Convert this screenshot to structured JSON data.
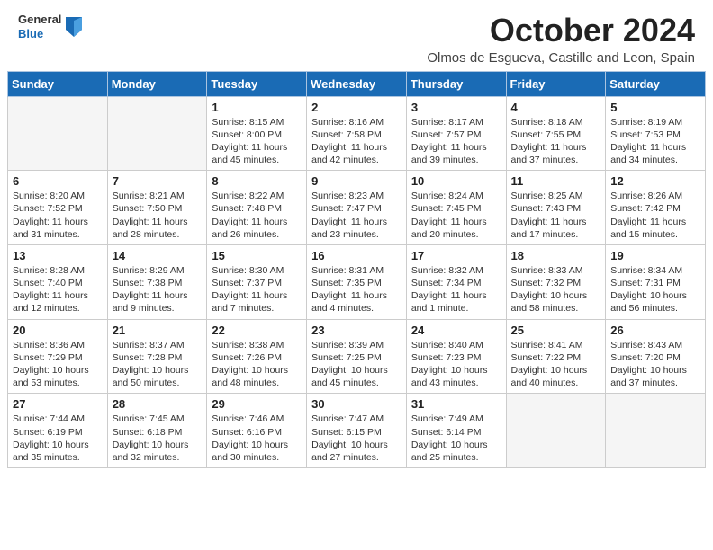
{
  "header": {
    "logo_line1": "General",
    "logo_line2": "Blue",
    "month_title": "October 2024",
    "location": "Olmos de Esgueva, Castille and Leon, Spain"
  },
  "days_of_week": [
    "Sunday",
    "Monday",
    "Tuesday",
    "Wednesday",
    "Thursday",
    "Friday",
    "Saturday"
  ],
  "weeks": [
    [
      {
        "day": "",
        "info": ""
      },
      {
        "day": "",
        "info": ""
      },
      {
        "day": "1",
        "info": "Sunrise: 8:15 AM\nSunset: 8:00 PM\nDaylight: 11 hours and 45 minutes."
      },
      {
        "day": "2",
        "info": "Sunrise: 8:16 AM\nSunset: 7:58 PM\nDaylight: 11 hours and 42 minutes."
      },
      {
        "day": "3",
        "info": "Sunrise: 8:17 AM\nSunset: 7:57 PM\nDaylight: 11 hours and 39 minutes."
      },
      {
        "day": "4",
        "info": "Sunrise: 8:18 AM\nSunset: 7:55 PM\nDaylight: 11 hours and 37 minutes."
      },
      {
        "day": "5",
        "info": "Sunrise: 8:19 AM\nSunset: 7:53 PM\nDaylight: 11 hours and 34 minutes."
      }
    ],
    [
      {
        "day": "6",
        "info": "Sunrise: 8:20 AM\nSunset: 7:52 PM\nDaylight: 11 hours and 31 minutes."
      },
      {
        "day": "7",
        "info": "Sunrise: 8:21 AM\nSunset: 7:50 PM\nDaylight: 11 hours and 28 minutes."
      },
      {
        "day": "8",
        "info": "Sunrise: 8:22 AM\nSunset: 7:48 PM\nDaylight: 11 hours and 26 minutes."
      },
      {
        "day": "9",
        "info": "Sunrise: 8:23 AM\nSunset: 7:47 PM\nDaylight: 11 hours and 23 minutes."
      },
      {
        "day": "10",
        "info": "Sunrise: 8:24 AM\nSunset: 7:45 PM\nDaylight: 11 hours and 20 minutes."
      },
      {
        "day": "11",
        "info": "Sunrise: 8:25 AM\nSunset: 7:43 PM\nDaylight: 11 hours and 17 minutes."
      },
      {
        "day": "12",
        "info": "Sunrise: 8:26 AM\nSunset: 7:42 PM\nDaylight: 11 hours and 15 minutes."
      }
    ],
    [
      {
        "day": "13",
        "info": "Sunrise: 8:28 AM\nSunset: 7:40 PM\nDaylight: 11 hours and 12 minutes."
      },
      {
        "day": "14",
        "info": "Sunrise: 8:29 AM\nSunset: 7:38 PM\nDaylight: 11 hours and 9 minutes."
      },
      {
        "day": "15",
        "info": "Sunrise: 8:30 AM\nSunset: 7:37 PM\nDaylight: 11 hours and 7 minutes."
      },
      {
        "day": "16",
        "info": "Sunrise: 8:31 AM\nSunset: 7:35 PM\nDaylight: 11 hours and 4 minutes."
      },
      {
        "day": "17",
        "info": "Sunrise: 8:32 AM\nSunset: 7:34 PM\nDaylight: 11 hours and 1 minute."
      },
      {
        "day": "18",
        "info": "Sunrise: 8:33 AM\nSunset: 7:32 PM\nDaylight: 10 hours and 58 minutes."
      },
      {
        "day": "19",
        "info": "Sunrise: 8:34 AM\nSunset: 7:31 PM\nDaylight: 10 hours and 56 minutes."
      }
    ],
    [
      {
        "day": "20",
        "info": "Sunrise: 8:36 AM\nSunset: 7:29 PM\nDaylight: 10 hours and 53 minutes."
      },
      {
        "day": "21",
        "info": "Sunrise: 8:37 AM\nSunset: 7:28 PM\nDaylight: 10 hours and 50 minutes."
      },
      {
        "day": "22",
        "info": "Sunrise: 8:38 AM\nSunset: 7:26 PM\nDaylight: 10 hours and 48 minutes."
      },
      {
        "day": "23",
        "info": "Sunrise: 8:39 AM\nSunset: 7:25 PM\nDaylight: 10 hours and 45 minutes."
      },
      {
        "day": "24",
        "info": "Sunrise: 8:40 AM\nSunset: 7:23 PM\nDaylight: 10 hours and 43 minutes."
      },
      {
        "day": "25",
        "info": "Sunrise: 8:41 AM\nSunset: 7:22 PM\nDaylight: 10 hours and 40 minutes."
      },
      {
        "day": "26",
        "info": "Sunrise: 8:43 AM\nSunset: 7:20 PM\nDaylight: 10 hours and 37 minutes."
      }
    ],
    [
      {
        "day": "27",
        "info": "Sunrise: 7:44 AM\nSunset: 6:19 PM\nDaylight: 10 hours and 35 minutes."
      },
      {
        "day": "28",
        "info": "Sunrise: 7:45 AM\nSunset: 6:18 PM\nDaylight: 10 hours and 32 minutes."
      },
      {
        "day": "29",
        "info": "Sunrise: 7:46 AM\nSunset: 6:16 PM\nDaylight: 10 hours and 30 minutes."
      },
      {
        "day": "30",
        "info": "Sunrise: 7:47 AM\nSunset: 6:15 PM\nDaylight: 10 hours and 27 minutes."
      },
      {
        "day": "31",
        "info": "Sunrise: 7:49 AM\nSunset: 6:14 PM\nDaylight: 10 hours and 25 minutes."
      },
      {
        "day": "",
        "info": ""
      },
      {
        "day": "",
        "info": ""
      }
    ]
  ]
}
